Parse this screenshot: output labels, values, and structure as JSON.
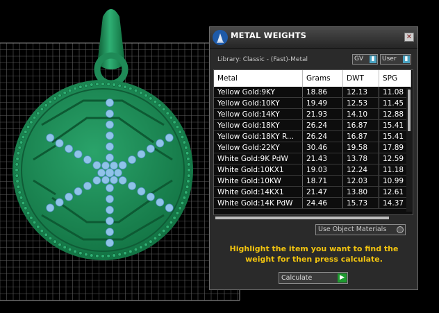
{
  "dialog": {
    "title": "METAL WEIGHTS",
    "library_label": "Library: Classic - (Fast)-Metal",
    "gv_toggle": "GV",
    "user_toggle": "User",
    "use_object_materials": "Use Object Materials",
    "hint": "Highlight the item you want to find the weight for then press calculate.",
    "calculate_label": "Calculate"
  },
  "table": {
    "headers": [
      "Metal",
      "Grams",
      "DWT",
      "SPG"
    ],
    "rows": [
      [
        "Yellow Gold:9KY",
        "18.86",
        "12.13",
        "11.08"
      ],
      [
        "Yellow Gold:10KY",
        "19.49",
        "12.53",
        "11.45"
      ],
      [
        "Yellow Gold:14KY",
        "21.93",
        "14.10",
        "12.88"
      ],
      [
        "Yellow Gold:18KY",
        "26.24",
        "16.87",
        "15.41"
      ],
      [
        "Yellow Gold:18KY R...",
        "26.24",
        "16.87",
        "15.41"
      ],
      [
        "Yellow Gold:22KY",
        "30.46",
        "19.58",
        "17.89"
      ],
      [
        "White Gold:9K PdW",
        "21.43",
        "13.78",
        "12.59"
      ],
      [
        "White Gold:10KX1",
        "19.03",
        "12.24",
        "11.18"
      ],
      [
        "White Gold:10KW",
        "18.71",
        "12.03",
        "10.99"
      ],
      [
        "White Gold:14KX1",
        "21.47",
        "13.80",
        "12.61"
      ],
      [
        "White Gold:14K PdW",
        "24.46",
        "15.73",
        "14.37"
      ]
    ]
  },
  "icons": {
    "title_icon": "metal-weights-flask-icon",
    "close": "close-icon",
    "toggle_knob": "toggle-icon",
    "radio": "radio-icon",
    "calculate_arrow": "play-arrow-icon"
  },
  "colors": {
    "pendant_green": "#1f8a57",
    "hint_yellow": "#f2c40f",
    "toggle_blue": "#4aa3c2",
    "calc_green": "#1e9b2f",
    "gem_blue": "#8fc3e8"
  }
}
